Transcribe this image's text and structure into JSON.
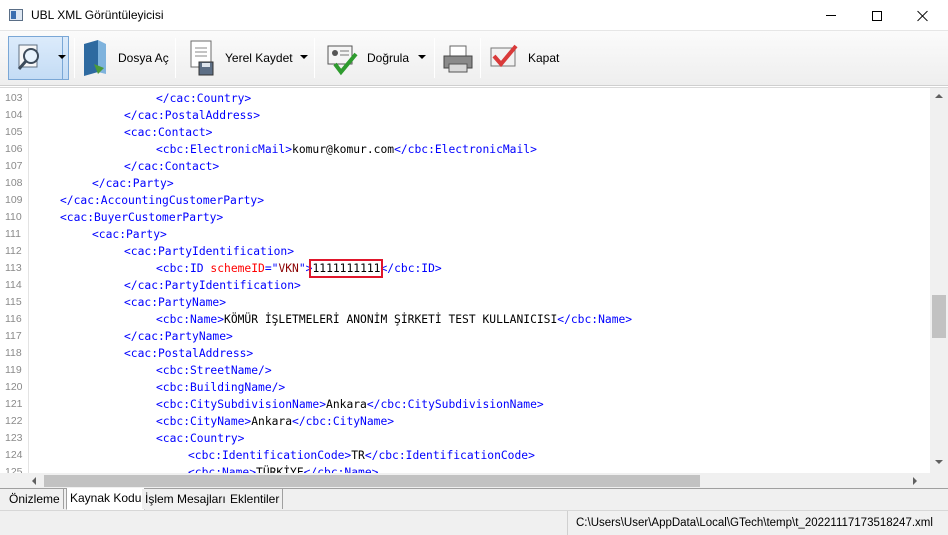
{
  "window": {
    "title": "UBL XML Görüntüleyicisi"
  },
  "toolbar": {
    "open_label": "Dosya Aç",
    "save_label": "Yerel Kaydet",
    "validate_label": "Doğrula",
    "close_label": "Kapat"
  },
  "editor": {
    "lines": [
      {
        "n": "103",
        "indent": 3,
        "parts": [
          {
            "c": "tag",
            "t": "</cac:Country>"
          }
        ]
      },
      {
        "n": "104",
        "indent": 2,
        "parts": [
          {
            "c": "tag",
            "t": "</cac:PostalAddress>"
          }
        ]
      },
      {
        "n": "105",
        "indent": 2,
        "parts": [
          {
            "c": "tag",
            "t": "<cac:Contact>"
          }
        ]
      },
      {
        "n": "106",
        "indent": 3,
        "parts": [
          {
            "c": "tag",
            "t": "<cbc:ElectronicMail>"
          },
          {
            "c": "txt",
            "t": "komur@komur.com"
          },
          {
            "c": "tag",
            "t": "</cbc:ElectronicMail>"
          }
        ]
      },
      {
        "n": "107",
        "indent": 2,
        "parts": [
          {
            "c": "tag",
            "t": "</cac:Contact>"
          }
        ]
      },
      {
        "n": "108",
        "indent": 1,
        "parts": [
          {
            "c": "tag",
            "t": "</cac:Party>"
          }
        ]
      },
      {
        "n": "109",
        "indent": 0,
        "parts": [
          {
            "c": "tag",
            "t": "</cac:AccountingCustomerParty>"
          }
        ]
      },
      {
        "n": "110",
        "indent": 0,
        "parts": [
          {
            "c": "tag",
            "t": "<cac:BuyerCustomerParty>"
          }
        ]
      },
      {
        "n": "111",
        "indent": 1,
        "parts": [
          {
            "c": "tag",
            "t": "<cac:Party>"
          }
        ]
      },
      {
        "n": "112",
        "indent": 2,
        "parts": [
          {
            "c": "tag",
            "t": "<cac:PartyIdentification>"
          }
        ]
      },
      {
        "n": "113",
        "indent": 3,
        "parts": [
          {
            "c": "tag",
            "t": "<cbc:ID "
          },
          {
            "c": "attr",
            "t": "schemeID"
          },
          {
            "c": "tag",
            "t": "=\""
          },
          {
            "c": "attrv",
            "t": "VKN"
          },
          {
            "c": "tag",
            "t": "\">"
          },
          {
            "c": "txt hl",
            "t": "1111111111"
          },
          {
            "c": "tag",
            "t": "</cbc:ID>"
          }
        ]
      },
      {
        "n": "114",
        "indent": 2,
        "parts": [
          {
            "c": "tag",
            "t": "</cac:PartyIdentification>"
          }
        ]
      },
      {
        "n": "115",
        "indent": 2,
        "parts": [
          {
            "c": "tag",
            "t": "<cac:PartyName>"
          }
        ]
      },
      {
        "n": "116",
        "indent": 3,
        "parts": [
          {
            "c": "tag",
            "t": "<cbc:Name>"
          },
          {
            "c": "txt",
            "t": "KÖMÜR İŞLETMELERİ ANONİM ŞİRKETİ TEST KULLANICISI"
          },
          {
            "c": "tag",
            "t": "</cbc:Name>"
          }
        ]
      },
      {
        "n": "117",
        "indent": 2,
        "parts": [
          {
            "c": "tag",
            "t": "</cac:PartyName>"
          }
        ]
      },
      {
        "n": "118",
        "indent": 2,
        "parts": [
          {
            "c": "tag",
            "t": "<cac:PostalAddress>"
          }
        ]
      },
      {
        "n": "119",
        "indent": 3,
        "parts": [
          {
            "c": "tag",
            "t": "<cbc:StreetName/>"
          }
        ]
      },
      {
        "n": "120",
        "indent": 3,
        "parts": [
          {
            "c": "tag",
            "t": "<cbc:BuildingName/>"
          }
        ]
      },
      {
        "n": "121",
        "indent": 3,
        "parts": [
          {
            "c": "tag",
            "t": "<cbc:CitySubdivisionName>"
          },
          {
            "c": "txt",
            "t": "Ankara"
          },
          {
            "c": "tag",
            "t": "</cbc:CitySubdivisionName>"
          }
        ]
      },
      {
        "n": "122",
        "indent": 3,
        "parts": [
          {
            "c": "tag",
            "t": "<cbc:CityName>"
          },
          {
            "c": "txt",
            "t": "Ankara"
          },
          {
            "c": "tag",
            "t": "</cbc:CityName>"
          }
        ]
      },
      {
        "n": "123",
        "indent": 3,
        "parts": [
          {
            "c": "tag",
            "t": "<cac:Country>"
          }
        ]
      },
      {
        "n": "124",
        "indent": 4,
        "parts": [
          {
            "c": "tag",
            "t": "<cbc:IdentificationCode>"
          },
          {
            "c": "txt",
            "t": "TR"
          },
          {
            "c": "tag",
            "t": "</cbc:IdentificationCode>"
          }
        ]
      },
      {
        "n": "125",
        "indent": 4,
        "parts": [
          {
            "c": "tag",
            "t": "<cbc:Name>"
          },
          {
            "c": "txt",
            "t": "TÜRKİYE"
          },
          {
            "c": "tag",
            "t": "</cbc:Name>"
          }
        ]
      }
    ]
  },
  "tabs": [
    {
      "label": "Önizleme",
      "active": false
    },
    {
      "label": "Kaynak Kodu",
      "active": true
    },
    {
      "label": "İşlem Mesajları",
      "active": false
    },
    {
      "label": "Eklentiler",
      "active": false
    }
  ],
  "status": {
    "file_path": "C:\\Users\\User\\AppData\\Local\\GTech\\temp\\t_20221117173518247.xml"
  },
  "colors": {
    "tag": "#0000ff",
    "attribute_name": "#ff0000",
    "attribute_value": "#8b0000",
    "highlight_box": "#e0162b"
  },
  "icons": [
    "app-icon",
    "magnifier-preview-icon",
    "open-folder-icon",
    "save-document-icon",
    "validate-certificate-icon",
    "printer-icon",
    "close-check-icon"
  ]
}
